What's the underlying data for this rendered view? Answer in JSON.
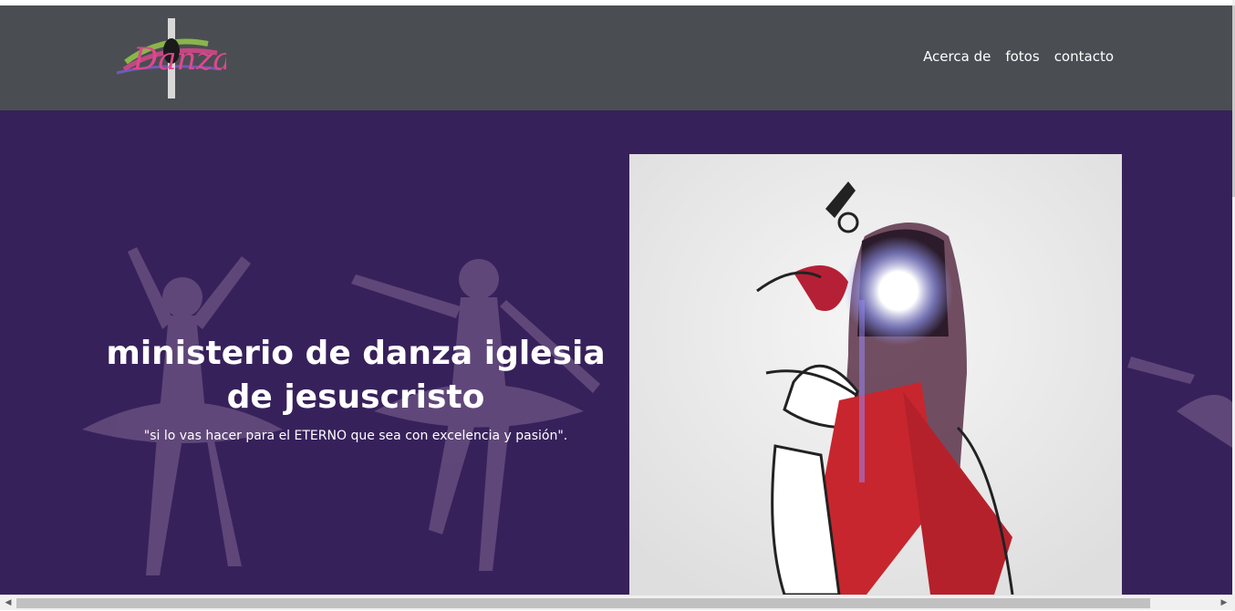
{
  "header": {
    "logo_text": "Danza",
    "nav": [
      {
        "label": "Acerca de"
      },
      {
        "label": "fotos"
      },
      {
        "label": "contacto"
      }
    ]
  },
  "hero": {
    "title": "ministerio de danza iglesia de jesuscristo",
    "subtitle": "\"si lo vas hacer para el ETERNO que sea con excelencia y pasión\"."
  },
  "scrollbar": {
    "left_arrow": "◀",
    "right_arrow": "▶"
  },
  "colors": {
    "header_bg": "#4a4e52",
    "hero_bg": "#37215b"
  }
}
